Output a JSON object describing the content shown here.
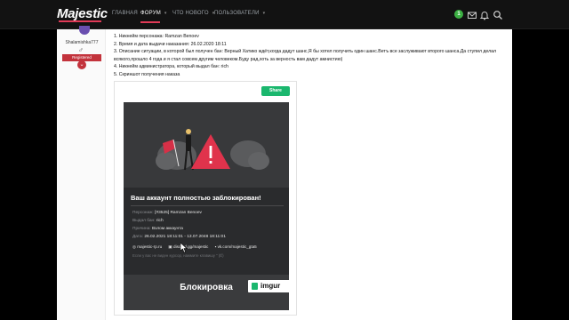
{
  "nav": {
    "logo": "Majestic",
    "items": [
      {
        "label": "ГЛАВНАЯ",
        "active": false,
        "caret": false
      },
      {
        "label": "ФОРУМ",
        "active": true,
        "caret": true
      },
      {
        "label": "ЧТО НОВОГО",
        "active": false,
        "caret": true
      },
      {
        "label": "ПОЛЬЗОВАТЕЛИ",
        "active": false,
        "caret": true
      }
    ],
    "notification_count": "1",
    "icons": [
      "mail-icon",
      "bell-icon",
      "search-icon"
    ],
    "accent": "#e03a57"
  },
  "sidebar": {
    "username": "Shalamishka777",
    "gender_symbol": "♂",
    "role": "Registered",
    "expand_symbol": "⌄"
  },
  "post": {
    "lines": [
      "1. Никнейм персонажа: Ramzan Benoev",
      "2. Время и дата выдачи наказания: 26.02.2020 18:11",
      "3. Описание ситуации, в которой был получен бан: Верный Хатико ждёт,когда дадут шанс,Я бы хотел получить один шанс.Ветъ все заслуживают второго шанса.Да ступил делал",
      "всякого,прошло 4 года и я стал совсем другим человеком.Буду рад,хоть за верность вам дадут амнистию)",
      "4. Никнейм администратора, который выдал бан: rich",
      "5. Скриншот получения наказа",
      "ния:"
    ]
  },
  "screenshot": {
    "share_label": "Share",
    "title": "Ваш аккаунт полностью заблокирован!",
    "rows": [
      {
        "label": "Персонаж:",
        "value": "[#3525] Ramzan Benoev"
      },
      {
        "label": "Выдал бан:",
        "value": "rich"
      },
      {
        "label": "Причина:",
        "value": "Взлом аккаунта"
      },
      {
        "label": "Дата:",
        "value": "26.02.2021 18:11:01 - 13.07.2048 18:11:01"
      }
    ],
    "links": [
      "majestic-rp.ru",
      "discord.gg/majestic",
      "vk.com/majestic_gta5"
    ],
    "note": "Если у вас не виден курсор, нажмите клавишу \" (Ё)",
    "block_label": "Блокировка",
    "imgur_label": "imgur",
    "colors": {
      "panel": "#2a2b2d",
      "danger": "#e0334c",
      "share": "#1bb76e"
    }
  }
}
